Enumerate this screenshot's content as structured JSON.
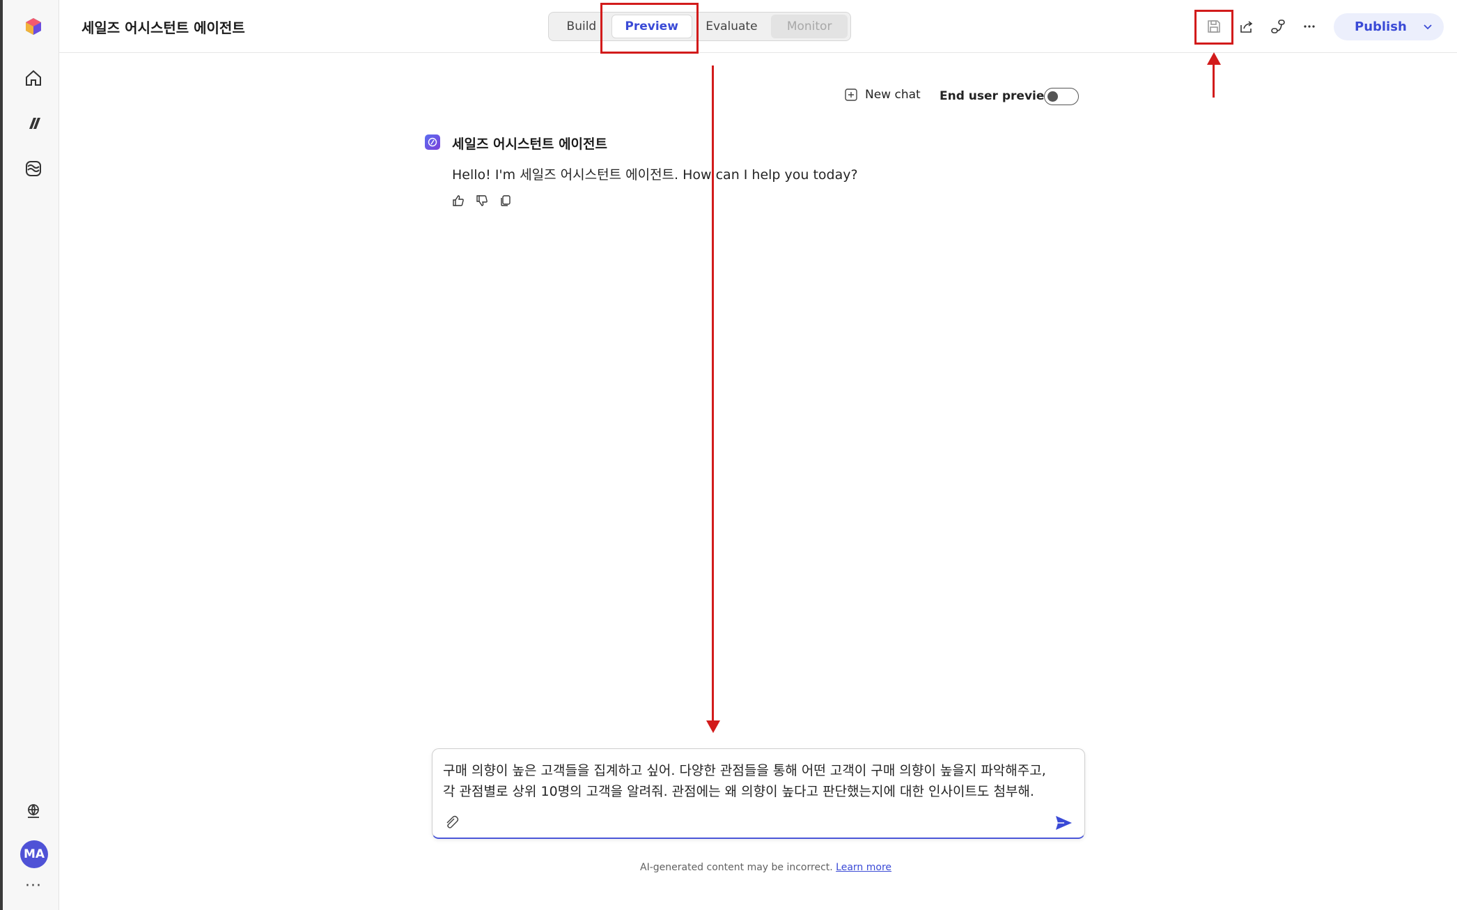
{
  "app": {
    "agent_title": "세일즈 어시스턴트 에이전트"
  },
  "tabs": [
    {
      "label": "Build",
      "state": "default"
    },
    {
      "label": "Preview",
      "state": "selected"
    },
    {
      "label": "Evaluate",
      "state": "default"
    },
    {
      "label": "Monitor",
      "state": "disabled"
    }
  ],
  "header_actions": {
    "icons": [
      "save-icon",
      "share-icon",
      "connect-icon",
      "more-icon"
    ],
    "publish_label": "Publish"
  },
  "chat_controls": {
    "new_chat_label": "New chat",
    "end_user_preview_label": "End user preview",
    "end_user_preview_on": false
  },
  "message": {
    "bot_name": "세일즈 어시스턴트 에이전트",
    "text": "Hello! I'm 세일즈 어시스턴트 에이전트. How can I help you today?"
  },
  "composer": {
    "text": "구매 의향이 높은 고객들을 집계하고 싶어. 다양한 관점들을 통해 어떤 고객이 구매 의향이 높을지 파악해주고,\n각 관점별로 상위 10명의 고객을 알려줘. 관점에는 왜 의향이 높다고 판단했는지에 대한 인사이트도 첨부해."
  },
  "footer": {
    "disclaimer": "AI-generated content may be incorrect.",
    "learn_more": "Learn more"
  },
  "rail": {
    "avatar_initials": "MA"
  },
  "colors": {
    "accent": "#3a4ad6",
    "annotation": "#d21b1b"
  }
}
